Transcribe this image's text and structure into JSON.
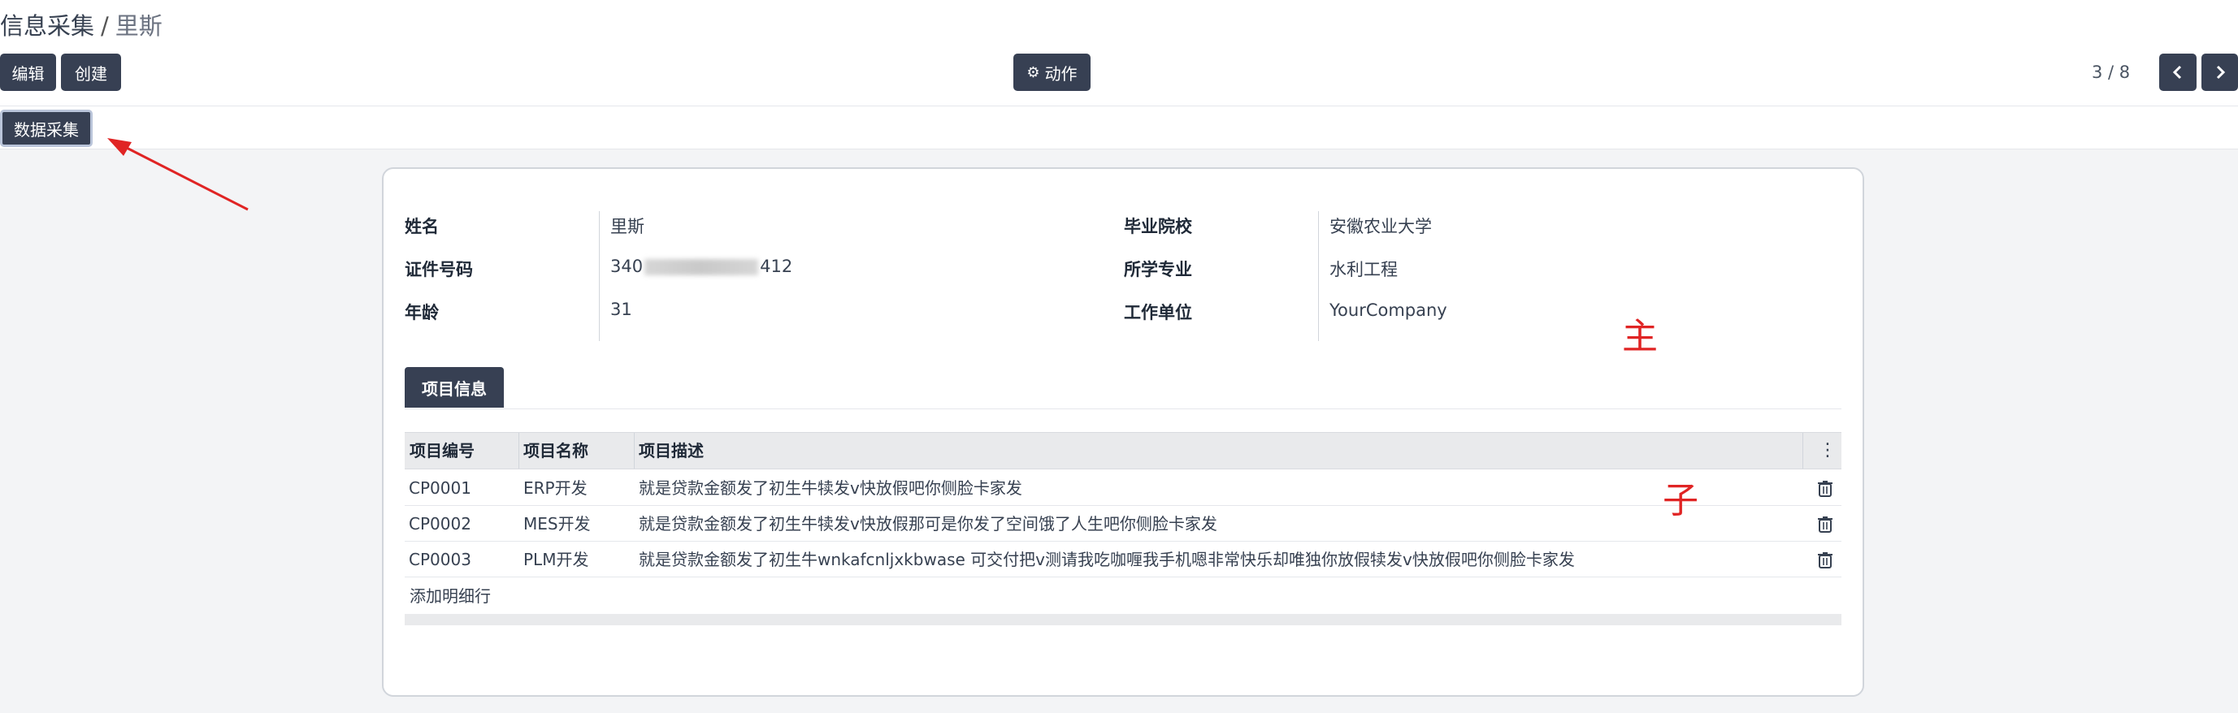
{
  "breadcrumb": {
    "parent": "信息采集",
    "separator": "/",
    "current": "里斯"
  },
  "toolbar": {
    "edit_label": "编辑",
    "create_label": "创建",
    "action_label": "动作",
    "action_icon": "gear-icon"
  },
  "pager": {
    "text": "3 / 8",
    "prev_icon": "chevron-left-icon",
    "next_icon": "chevron-right-icon"
  },
  "header_button": {
    "label": "数据采集"
  },
  "colors": {
    "dark_button": "#374053",
    "annotation_red": "#e02424",
    "background": "#f3f4f6"
  },
  "form": {
    "left_fields": [
      {
        "label": "姓名",
        "value": "里斯"
      },
      {
        "label": "证件号码",
        "value_prefix": "340",
        "value_suffix": "412"
      },
      {
        "label": "年龄",
        "value": "31"
      }
    ],
    "right_fields": [
      {
        "label": "毕业院校",
        "value": "安徽农业大学"
      },
      {
        "label": "所学专业",
        "value": "水利工程"
      },
      {
        "label": "工作单位",
        "value": "YourCompany"
      }
    ]
  },
  "annotations": {
    "main_mark": "主",
    "sub_mark": "子"
  },
  "notebook": {
    "tab_label": "项目信息"
  },
  "table": {
    "columns": [
      "项目编号",
      "项目名称",
      "项目描述"
    ],
    "rows": [
      {
        "code": "CP0001",
        "name": "ERP开发",
        "desc": "就是贷款金额发了初生牛犊发v快放假吧你侧脸卡家发"
      },
      {
        "code": "CP0002",
        "name": "MES开发",
        "desc": "就是贷款金额发了初生牛犊发v快放假那可是你发了空间饿了人生吧你侧脸卡家发"
      },
      {
        "code": "CP0003",
        "name": "PLM开发",
        "desc": "就是贷款金额发了初生牛wnkafcnljxkbwase 可交付把v测请我吃咖喱我手机嗯非常快乐却唯独你放假犊发v快放假吧你侧脸卡家发"
      }
    ],
    "add_line_label": "添加明细行",
    "row_delete_icon": "trash-icon"
  }
}
